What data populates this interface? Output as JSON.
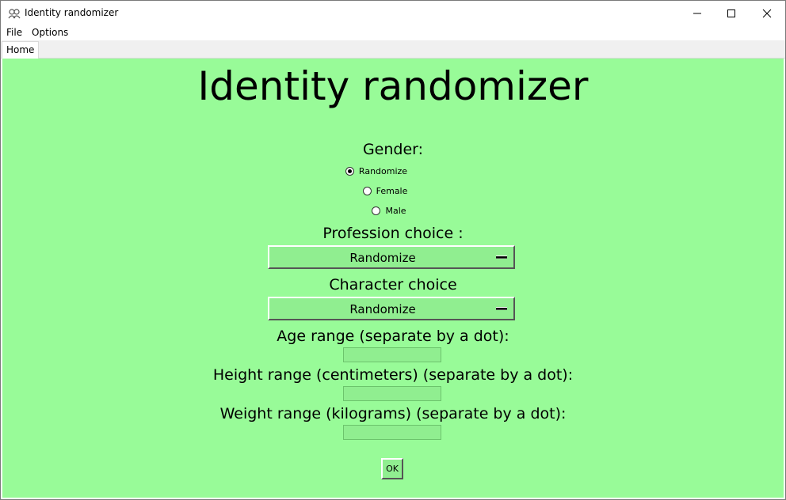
{
  "window": {
    "title": "Identity randomizer",
    "icon": "app-icon",
    "controls": [
      "minimize-icon",
      "maximize-icon",
      "close-icon"
    ]
  },
  "menubar": {
    "items": [
      {
        "label": "File"
      },
      {
        "label": "Options"
      }
    ]
  },
  "tabs": [
    {
      "label": "Home",
      "selected": true
    }
  ],
  "main": {
    "heading": "Identity randomizer",
    "gender": {
      "label": "Gender:",
      "options": [
        {
          "label": "Randomize",
          "selected": true
        },
        {
          "label": "Female",
          "selected": false
        },
        {
          "label": "Male",
          "selected": false
        }
      ]
    },
    "profession": {
      "label": "Profession choice :",
      "value": "Randomize"
    },
    "character": {
      "label": "Character choice",
      "value": "Randomize"
    },
    "age": {
      "label": "Age range (separate by a dot):",
      "value": ""
    },
    "height": {
      "label": "Height range (centimeters) (separate by a dot):",
      "value": ""
    },
    "weight": {
      "label": "Weight range (kilograms) (separate by a dot):",
      "value": ""
    },
    "ok_label": "OK"
  },
  "colors": {
    "background": "#98fb98",
    "widget": "#90ee90"
  }
}
